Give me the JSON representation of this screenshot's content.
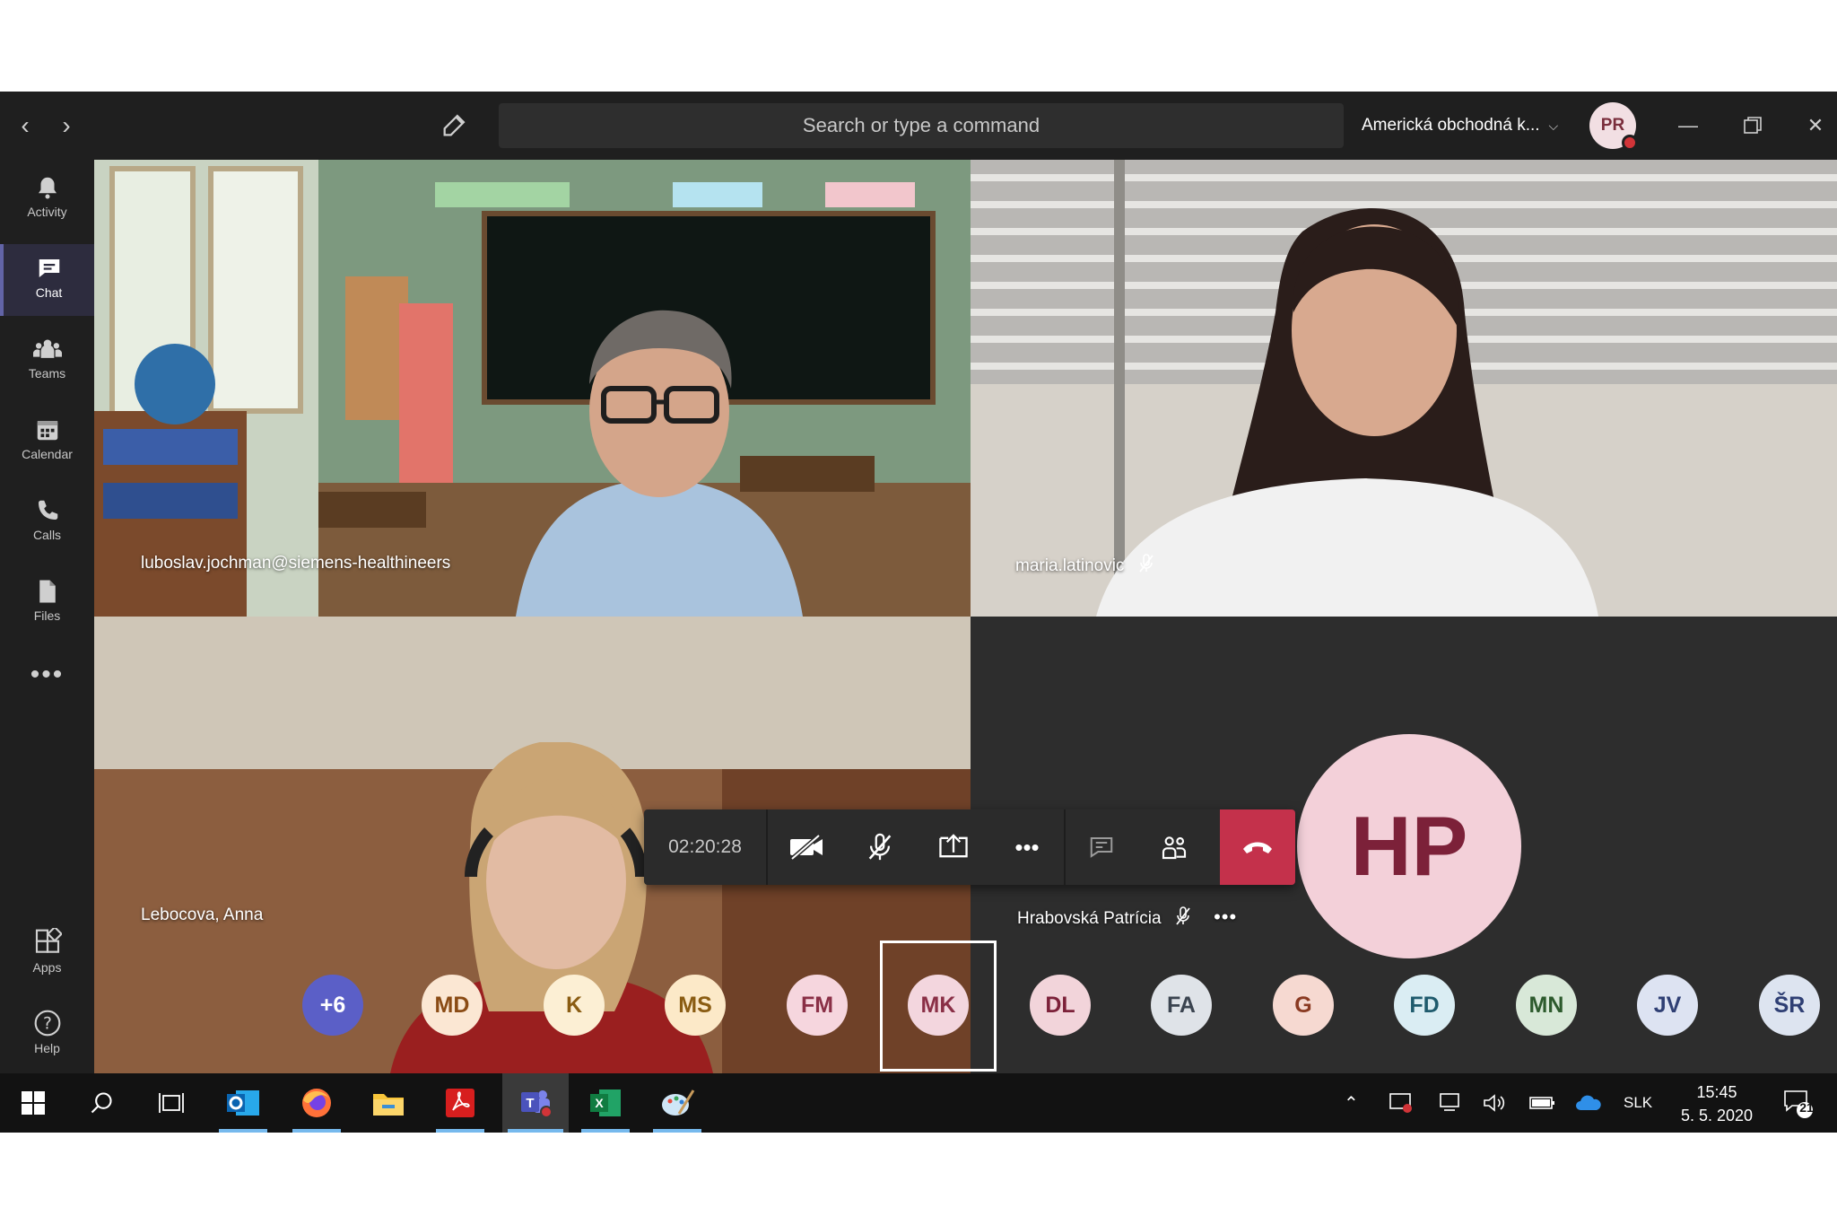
{
  "window": {
    "search_placeholder": "Search or type a command",
    "org_name": "Americká obchodná k...",
    "user_initials": "PR",
    "presence_color": "#d13438"
  },
  "sidebar": {
    "items": [
      {
        "label": "Activity",
        "icon": "bell-icon"
      },
      {
        "label": "Chat",
        "icon": "chat-icon",
        "active": true
      },
      {
        "label": "Teams",
        "icon": "teams-icon"
      },
      {
        "label": "Calendar",
        "icon": "calendar-icon"
      },
      {
        "label": "Calls",
        "icon": "phone-icon"
      },
      {
        "label": "Files",
        "icon": "file-icon"
      },
      {
        "label": "",
        "icon": "more-icon"
      }
    ],
    "bottom": [
      {
        "label": "Apps",
        "icon": "apps-icon"
      },
      {
        "label": "Help",
        "icon": "help-icon"
      }
    ]
  },
  "meeting": {
    "participants": [
      {
        "name": "luboslav.jochman@siemens-healthineers",
        "muted": false
      },
      {
        "name": "maria.latinovic",
        "muted": true
      },
      {
        "name": "Lebocova, Anna",
        "muted": false
      },
      {
        "name": "Hrabovská Patrícia",
        "muted": true,
        "initials": "HP"
      }
    ],
    "duration": "02:20:28",
    "controls": [
      "camera-off-icon",
      "mic-off-icon",
      "share-screen-icon",
      "more-icon",
      "chat-icon",
      "participants-icon",
      "hang-up-icon"
    ],
    "accent": "#c4314b"
  },
  "strip": {
    "overflow": "+6",
    "chips": [
      {
        "initials": "MD",
        "bg": "#fbe7d3",
        "fg": "#8a4b14"
      },
      {
        "initials": "K",
        "bg": "#fcefd4",
        "fg": "#8a5c12"
      },
      {
        "initials": "MS",
        "bg": "#fce9c8",
        "fg": "#8a5c12"
      },
      {
        "initials": "FM",
        "bg": "#f6d6de",
        "fg": "#8a2f46"
      },
      {
        "initials": "MK",
        "bg": "#f3d6de",
        "fg": "#8a2f46",
        "selected": true
      },
      {
        "initials": "DL",
        "bg": "#f2d4da",
        "fg": "#7c2139"
      },
      {
        "initials": "FA",
        "bg": "#dfe3e8",
        "fg": "#3b4450"
      },
      {
        "initials": "G",
        "bg": "#f6d9d1",
        "fg": "#8a3a22"
      },
      {
        "initials": "FD",
        "bg": "#daedf3",
        "fg": "#1f5b6d"
      },
      {
        "initials": "MN",
        "bg": "#d8e8d8",
        "fg": "#2d5a2d"
      },
      {
        "initials": "JV",
        "bg": "#dde3f2",
        "fg": "#2f3f74"
      },
      {
        "initials": "ŠR",
        "bg": "#dde4f0",
        "fg": "#2f3f74"
      }
    ]
  },
  "taskbar": {
    "language": "SLK",
    "time": "15:45",
    "date": "5. 5. 2020",
    "notifications": "21"
  }
}
